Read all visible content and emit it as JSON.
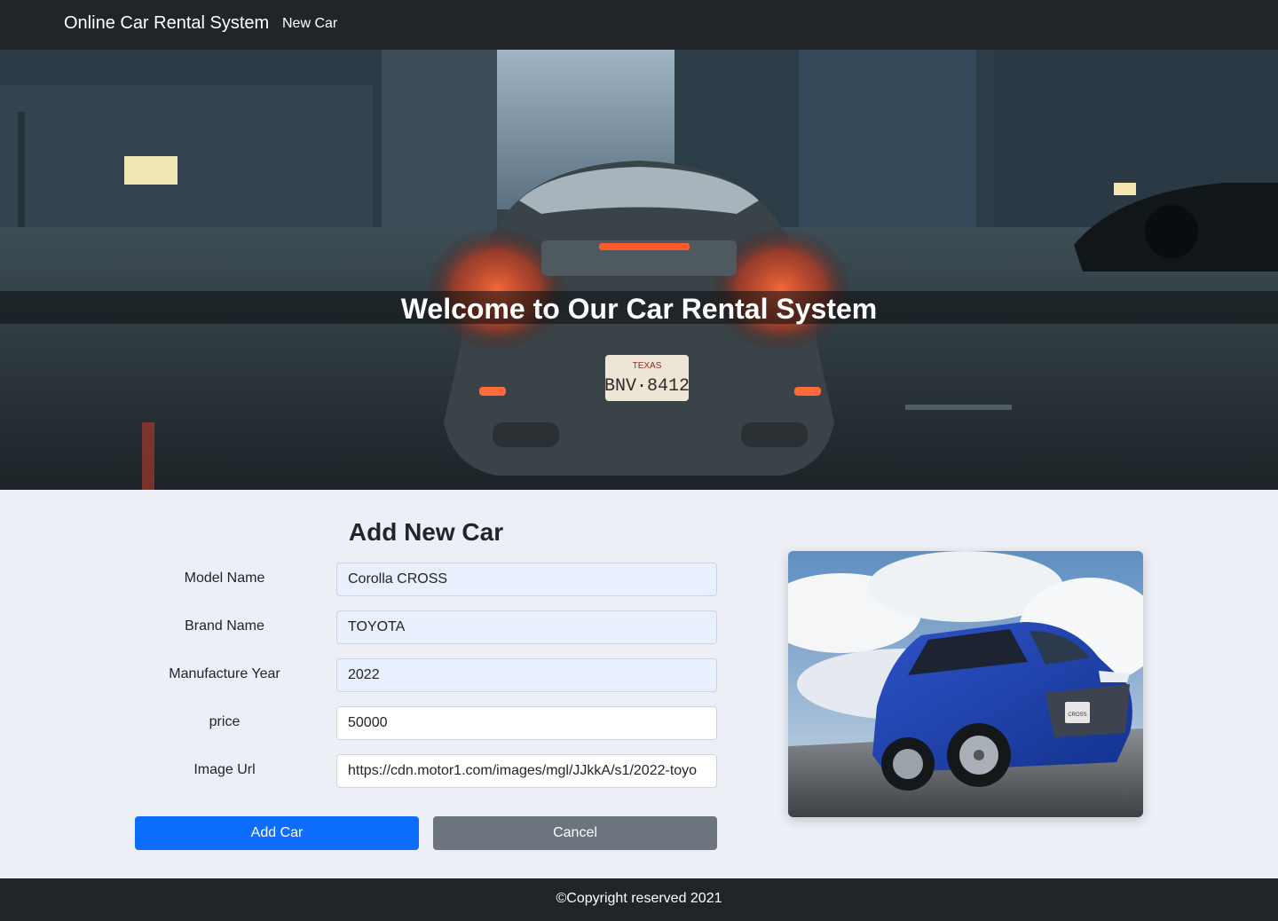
{
  "navbar": {
    "brand": "Online Car Rental System",
    "links": [
      {
        "label": "New Car"
      }
    ]
  },
  "hero": {
    "title": "Welcome to Our Car Rental System",
    "plate_state": "TEXAS",
    "plate_number": "BNV·8412"
  },
  "form": {
    "title": "Add New Car",
    "fields": [
      {
        "label": "Model Name",
        "value": "Corolla CROSS"
      },
      {
        "label": "Brand Name",
        "value": "TOYOTA"
      },
      {
        "label": "Manufacture Year",
        "value": "2022"
      },
      {
        "label": "price",
        "value": "50000"
      },
      {
        "label": "Image Url",
        "value": "https://cdn.motor1.com/images/mgl/JJkkA/s1/2022-toyo"
      }
    ],
    "submit_label": "Add Car",
    "cancel_label": "Cancel"
  },
  "preview": {
    "plate_text": "CROSS"
  },
  "footer": {
    "text": "©Copyright reserved 2021"
  },
  "colors": {
    "navbar_bg": "#212529",
    "primary": "#0d6efd",
    "secondary": "#6c757d",
    "page_bg": "#ecf0f6",
    "autofill_bg": "#e8f0fe"
  }
}
